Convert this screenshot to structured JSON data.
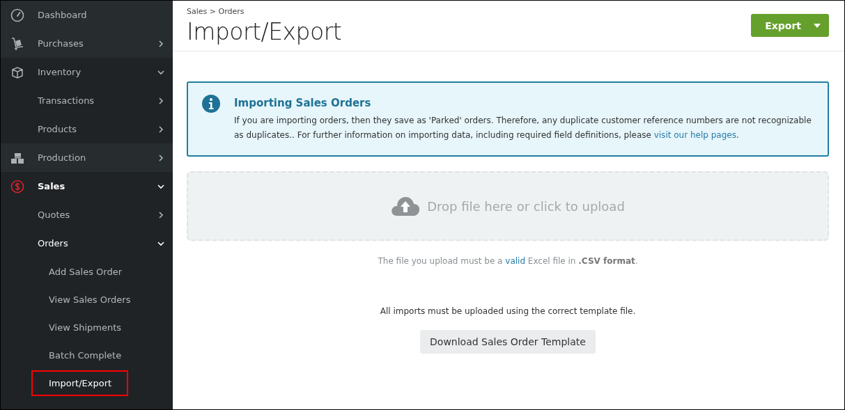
{
  "sidebar": {
    "items": [
      {
        "label": "Dashboard",
        "selected": false
      },
      {
        "label": "Purchases",
        "selected": false,
        "expanded": false
      },
      {
        "label": "Inventory",
        "selected": false,
        "expanded": true,
        "children": [
          {
            "label": "Transactions",
            "selected": false,
            "expanded": false
          },
          {
            "label": "Products",
            "selected": false,
            "expanded": false
          }
        ]
      },
      {
        "label": "Production",
        "selected": false,
        "expanded": false
      },
      {
        "label": "Sales",
        "selected": true,
        "expanded": true,
        "children": [
          {
            "label": "Quotes",
            "selected": false,
            "expanded": false
          },
          {
            "label": "Orders",
            "selected": true,
            "expanded": true,
            "children": [
              {
                "label": "Add Sales Order",
                "selected": false
              },
              {
                "label": "View Sales Orders",
                "selected": false
              },
              {
                "label": "View Shipments",
                "selected": false
              },
              {
                "label": "Batch Complete",
                "selected": false
              },
              {
                "label": "Import/Export",
                "selected": true,
                "highlighted": true
              }
            ]
          }
        ]
      }
    ]
  },
  "breadcrumb": "Sales > Orders",
  "title": "Import/Export",
  "export_button": "Export",
  "info": {
    "title": "Importing Sales Orders",
    "text": "If you are importing orders, then they save as 'Parked' orders. Therefore, any duplicate customer reference numbers are not recognizable as duplicates.. For further information on importing data, including required field definitions, please ",
    "link": "visit our help pages",
    "text_after": "."
  },
  "dropzone": "Drop file here or click to upload",
  "file_note": {
    "text": "The file you upload must be a ",
    "link": "valid",
    "text_after": " Excel file in **.CSV format**."
  },
  "template_note": "All imports must be uploaded using the correct template file.",
  "template_button": "Download Sales Order Template"
}
